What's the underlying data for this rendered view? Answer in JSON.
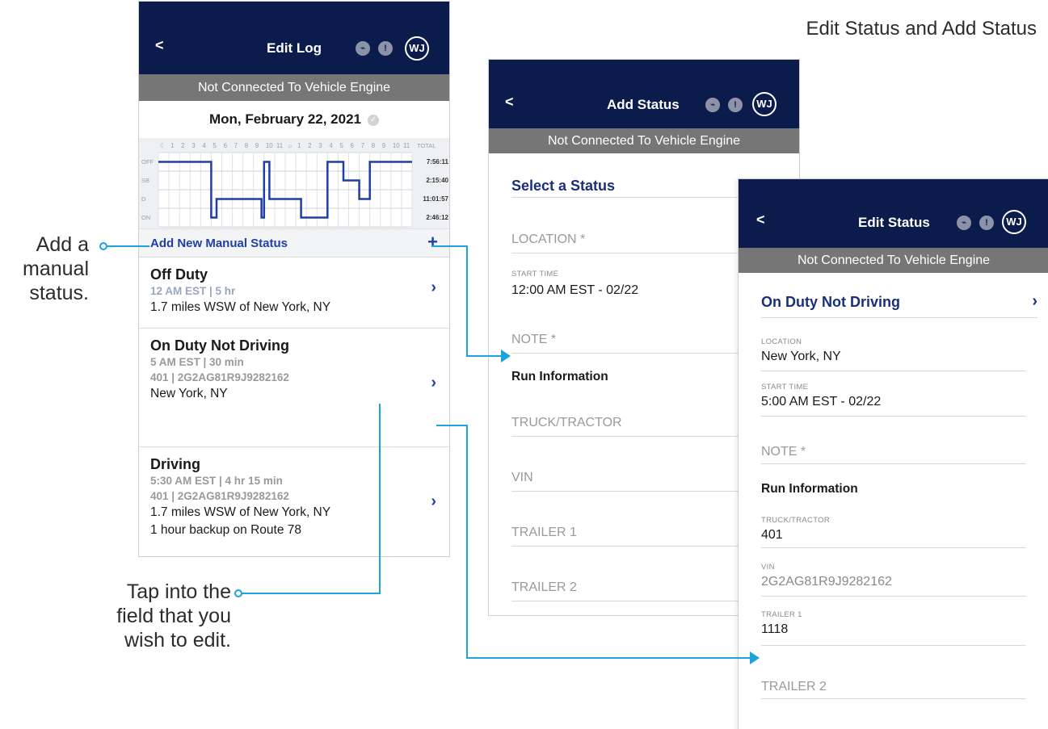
{
  "page_heading": "Edit Status and Add Status",
  "callouts": {
    "add_manual": [
      "Add a",
      "manual",
      "status."
    ],
    "tap_field": [
      "Tap into the",
      "field that you",
      "wish to edit."
    ]
  },
  "colors": {
    "header_bg": "#0b1b4c",
    "connection_bar_bg": "#767676",
    "accent_blue": "#1f3ea6",
    "connector_line": "#1aa3dd"
  },
  "edit_log": {
    "header": {
      "back_label": "<",
      "title": "Edit Log",
      "avatar": "WJ",
      "icons": [
        "activity-icon",
        "alert-icon"
      ]
    },
    "connection_status": "Not Connected To Vehicle Engine",
    "date": "Mon, February 22, 2021",
    "chart": {
      "hour_labels": [
        "☾",
        "1",
        "2",
        "3",
        "4",
        "5",
        "6",
        "7",
        "8",
        "9",
        "10",
        "11",
        "☼",
        "1",
        "2",
        "3",
        "4",
        "5",
        "6",
        "7",
        "8",
        "9",
        "10",
        "11"
      ],
      "total_label": "TOTAL",
      "rows": [
        "OFF",
        "SB",
        "D",
        "ON"
      ],
      "totals": [
        "7:56:11",
        "2:15:40",
        "11:01:57",
        "2:46:12"
      ]
    },
    "add_manual": {
      "label": "Add New Manual Status",
      "plus": "+"
    },
    "entries": [
      {
        "title": "Off Duty",
        "time": "12 AM EST | 5 hr",
        "vehicle": "",
        "location": "1.7 miles WSW of New York, NY",
        "note": ""
      },
      {
        "title": "On Duty Not Driving",
        "time": "5 AM EST | 30 min",
        "vehicle": "401 | 2G2AG81R9J9282162",
        "location": "New York, NY",
        "note": ""
      },
      {
        "title": "Driving",
        "time": "5:30 AM EST | 4 hr 15 min",
        "vehicle": "401 | 2G2AG81R9J9282162",
        "location": "1.7 miles WSW of New York, NY",
        "note": "1 hour backup on Route 78"
      }
    ],
    "chevron": "›"
  },
  "add_status": {
    "header": {
      "back_label": "<",
      "title": "Add Status",
      "avatar": "WJ",
      "icons": [
        "activity-icon",
        "alert-icon"
      ]
    },
    "connection_status": "Not Connected To Vehicle Engine",
    "select_status": "Select a Status",
    "location_placeholder": "LOCATION *",
    "start_time_label": "START TIME",
    "start_time_value": "12:00 AM EST - 02/22",
    "note_placeholder": "NOTE *",
    "run_info_label": "Run Information",
    "truck_placeholder": "TRUCK/TRACTOR",
    "vin_placeholder": "VIN",
    "trailer1_placeholder": "TRAILER 1",
    "trailer2_placeholder": "TRAILER 2"
  },
  "edit_status": {
    "header": {
      "back_label": "<",
      "title": "Edit Status",
      "avatar": "WJ",
      "icons": [
        "activity-icon",
        "alert-icon"
      ]
    },
    "connection_status": "Not Connected To Vehicle Engine",
    "status": "On Duty Not Driving",
    "chevron": "›",
    "location_label": "LOCATION",
    "location_value": "New York, NY",
    "start_time_label": "START TIME",
    "start_time_value": "5:00 AM EST - 02/22",
    "note_placeholder": "NOTE *",
    "run_info_label": "Run Information",
    "truck_label": "TRUCK/TRACTOR",
    "truck_value": "401",
    "vin_label": "VIN",
    "vin_value": "2G2AG81R9J9282162",
    "trailer1_label": "TRAILER 1",
    "trailer1_value": "1118",
    "trailer2_placeholder": "TRAILER 2"
  }
}
